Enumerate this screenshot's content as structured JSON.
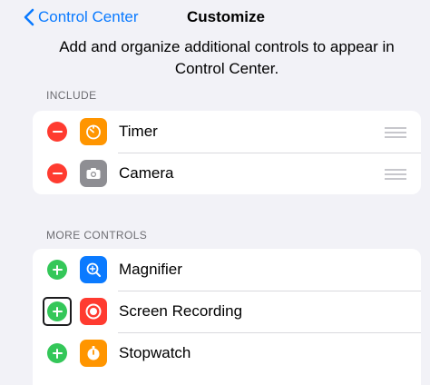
{
  "nav": {
    "back_label": "Control Center",
    "title": "Customize"
  },
  "description": "Add and organize additional controls to appear in Control Center.",
  "include": {
    "header": "INCLUDE",
    "items": [
      {
        "label": "Timer",
        "icon": "timer-icon",
        "icon_color": "#ff9500"
      },
      {
        "label": "Camera",
        "icon": "camera-icon",
        "icon_color": "#8e8e93"
      }
    ]
  },
  "more_controls": {
    "header": "MORE CONTROLS",
    "items": [
      {
        "label": "Magnifier",
        "icon": "magnifier-icon",
        "icon_color": "#0a7aff"
      },
      {
        "label": "Screen Recording",
        "icon": "screen-recording-icon",
        "icon_color": "#ff3b30"
      },
      {
        "label": "Stopwatch",
        "icon": "stopwatch-icon",
        "icon_color": "#ff9500"
      }
    ]
  },
  "colors": {
    "accent": "#0a7aff",
    "remove": "#ff3b30",
    "add": "#34c759",
    "background": "#f2f2f7"
  }
}
